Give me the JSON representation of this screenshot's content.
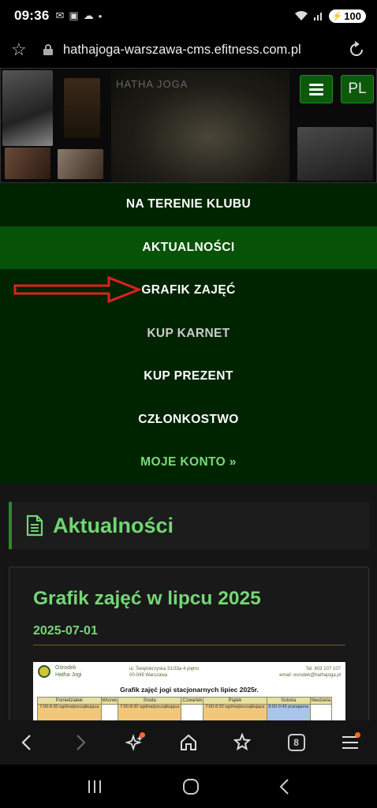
{
  "status": {
    "time": "09:36",
    "battery": "100"
  },
  "browser": {
    "url": "hathajoga-warszawa-cms.efitness.com.pl",
    "tab_count": "8"
  },
  "banner": {
    "title": "HATHA JOGA",
    "lang": "PL"
  },
  "nav": {
    "items": [
      {
        "label": "NA TERENIE KLUBU"
      },
      {
        "label": "AKTUALNOŚCI"
      },
      {
        "label": "GRAFIK ZAJĘĆ"
      },
      {
        "label": "KUP KARNET"
      },
      {
        "label": "KUP PREZENT"
      },
      {
        "label": "CZŁONKOSTWO"
      },
      {
        "label": "MOJE KONTO »"
      }
    ]
  },
  "section": {
    "title": "Aktualności"
  },
  "post": {
    "title": "Grafik zajęć w lipcu 2025",
    "date": "2025-07-01",
    "schedule": {
      "org_line1": "Ośrodek",
      "org_line2": "Hatha Jogi",
      "addr_line1": "ul. Świętokrzyska 31/33a 4 piętro",
      "addr_line2": "00-049 Warszawa",
      "phone": "Tel. 603 107 107",
      "email": "email: osrodek@hathajoga.pl",
      "title": "Grafik zajęć jogi stacjonarnych lipiec 2025r.",
      "days": [
        "Poniedziałek",
        "Wtorek",
        "Środa",
        "Czwartek",
        "Piątek",
        "Sobota",
        "Niedziela"
      ],
      "cells": [
        "7:00-8:30 ogólna/początkująca",
        "",
        "7:00-8:30 ogólna/początkująca",
        "",
        "7:00-8:30 ogólna/początkująca",
        "8:00-9:45 pranajama",
        ""
      ]
    }
  },
  "colors": {
    "accent": "#6ed86e",
    "nav_bg": "#002400",
    "nav_active": "#065206",
    "annotation_arrow": "#e02020"
  }
}
